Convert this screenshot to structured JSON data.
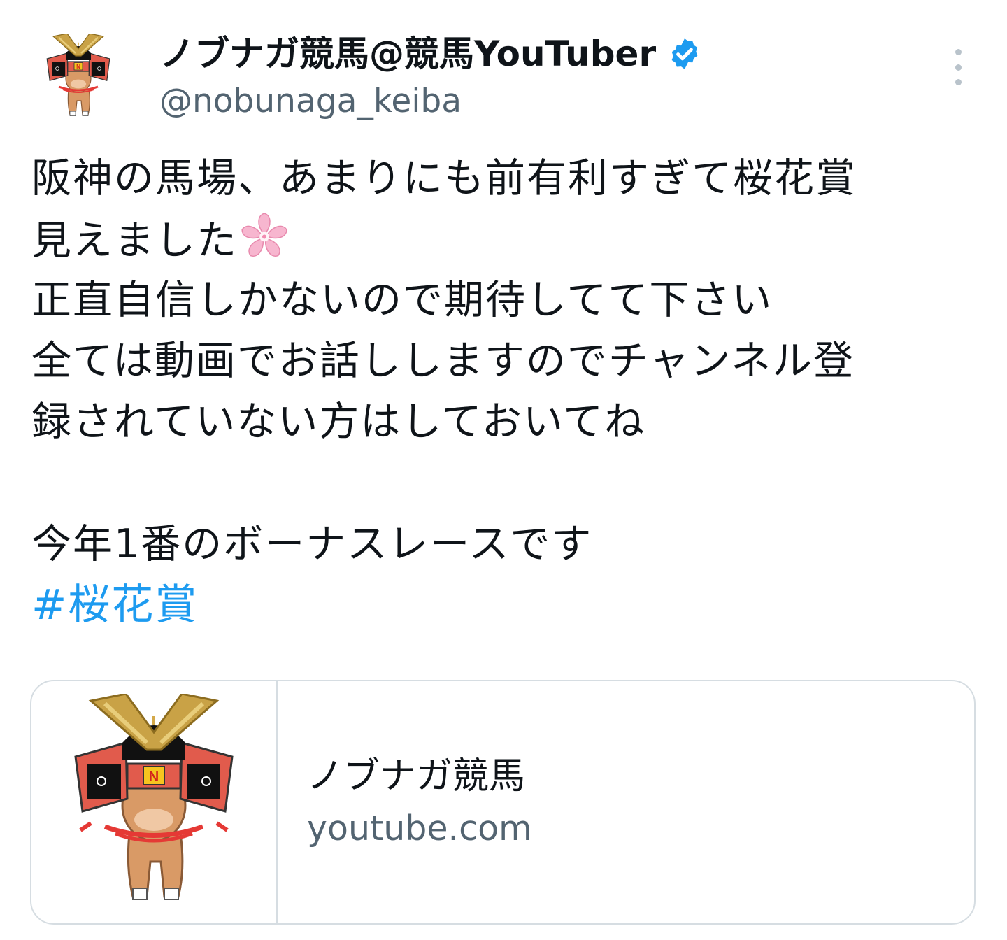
{
  "tweet": {
    "author": {
      "display_name": "ノブナガ競馬@競馬YouTuber",
      "handle": "@nobunaga_keiba",
      "avatar_icon": "samurai-horse-mascot-icon",
      "verified_icon": "verified-badge-icon",
      "verified_color": "#1d9bf0"
    },
    "more_icon": "more-vertical-icon",
    "text_lines": [
      "阪神の馬場、あまりにも前有利すぎて桜花賞",
      "見えました",
      "正直自信しかないので期待してて下さい",
      "全ては動画でお話ししますのでチャンネル登",
      "録されていない方はしておいてね",
      "今年1番のボーナスレースです"
    ],
    "emoji": "cherry-blossom-icon",
    "hashtag": "#桜花賞",
    "hashtag_color": "#1d9bf0",
    "link_card": {
      "title": "ノブナガ競馬",
      "domain": "youtube.com",
      "thumbnail_icon": "samurai-horse-mascot-icon"
    }
  }
}
